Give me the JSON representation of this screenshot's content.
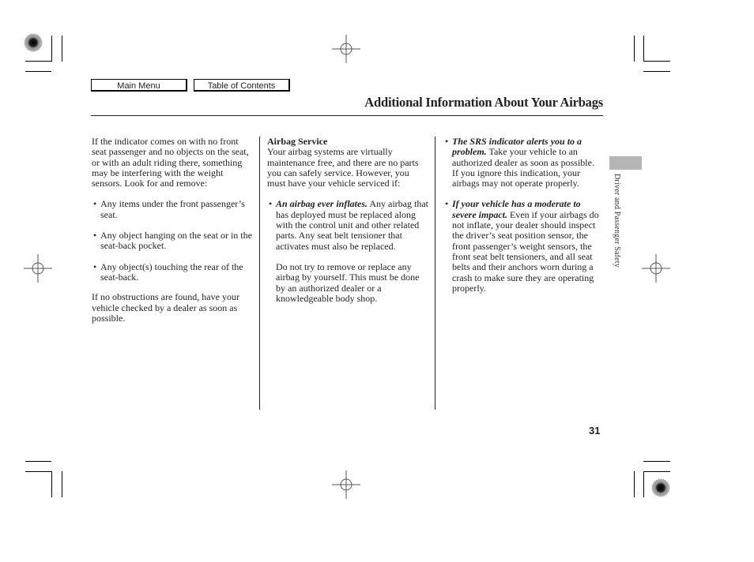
{
  "nav": {
    "main_menu_label": "Main Menu",
    "toc_label": "Table of Contents"
  },
  "header": {
    "title": "Additional Information About Your Airbags"
  },
  "side_tab": {
    "label": "Driver and Passenger Safety",
    "color": "#b5b5b5"
  },
  "page_number": "31",
  "column1": {
    "intro": "If the indicator comes on with no front seat passenger and no objects on the seat, or with an adult riding there, something may be interfering with the weight sensors. Look for and remove:",
    "bullets": [
      "Any items under the front passenger’s seat.",
      "Any object hanging on the seat or in the seat-back pocket.",
      "Any object(s) touching the rear of the seat-back."
    ],
    "closing": "If no obstructions are found, have your vehicle checked by a dealer as soon as possible."
  },
  "column2": {
    "heading": "Airbag Service",
    "intro": "Your airbag systems are virtually maintenance free, and there are no parts you can safely service. However, you must have your vehicle serviced if:",
    "bullets": [
      {
        "lead": "An airbag ever inflates.",
        "text": " Any airbag that has deployed must be replaced along with the control unit and other related parts. Any seat belt tensioner that activates must also be replaced."
      }
    ],
    "note": "Do not try to remove or replace any airbag by yourself. This must be done by an authorized dealer or a knowledgeable body shop."
  },
  "column3": {
    "bullets": [
      {
        "lead": "The SRS indicator alerts you to a problem.",
        "text": " Take your vehicle to an authorized dealer as soon as possible. If you ignore this indication, your airbags may not operate properly."
      },
      {
        "lead": "If your vehicle has a moderate to severe impact.",
        "text": " Even if your airbags do not inflate, your dealer should inspect the driver’s seat position sensor, the front passenger’s weight sensors, the front seat belt tensioners, and all seat belts and their anchors worn during a crash to make sure they are operating properly."
      }
    ]
  },
  "bullet_glyph": "•"
}
